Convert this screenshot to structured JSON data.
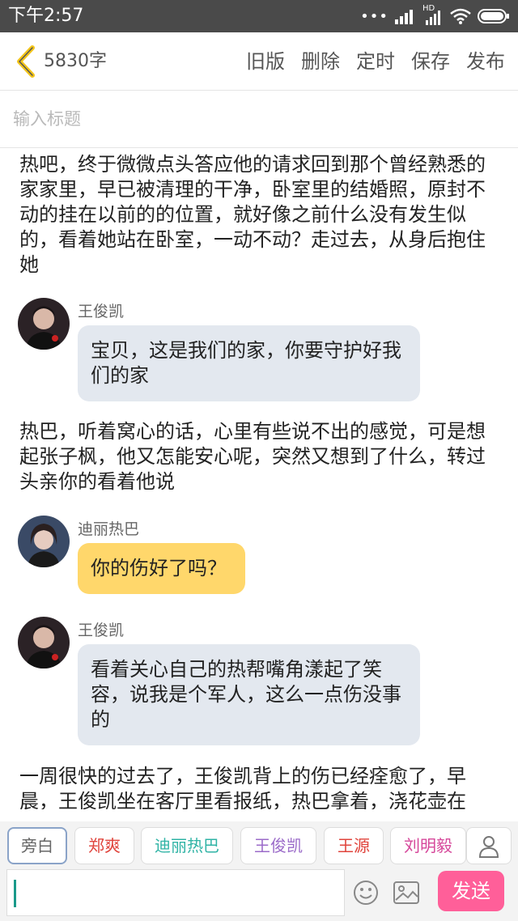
{
  "status": {
    "time": "下午2:57",
    "hd": "HD"
  },
  "toolbar": {
    "word_count": "5830字",
    "actions": [
      "旧版",
      "删除",
      "定时",
      "保存",
      "发布"
    ]
  },
  "title_placeholder": "输入标题",
  "story": [
    {
      "type": "narration",
      "text": "热吧，终于微微点头答应他的请求回到那个曾经熟悉的家家里，早已被清理的干净，卧室里的结婚照，原封不动的挂在以前的的位置，就好像之前什么没有发生似的，看着她站在卧室，一动不动？走过去，从身后抱住她"
    },
    {
      "type": "message",
      "speaker": "王俊凯",
      "text": "宝贝，这是我们的家，你要守护好我们的家",
      "color": "gray"
    },
    {
      "type": "narration",
      "text": "热巴，听着窝心的话，心里有些说不出的感觉，可是想起张子枫，他又怎能安心呢，突然又想到了什么，转过头亲你的看着他说"
    },
    {
      "type": "message",
      "speaker": "迪丽热巴",
      "text": "你的伤好了吗？",
      "color": "yellow"
    },
    {
      "type": "message",
      "speaker": "王俊凯",
      "text": "看着关心自己的热帮嘴角漾起了笑容，说我是个军人，这么一点伤没事的",
      "color": "gray"
    },
    {
      "type": "narration",
      "text": "一周很快的过去了，王俊凯背上的伤已经痊愈了，早晨，王俊凯坐在客厅里看报纸，热巴拿着，浇花壶在"
    }
  ],
  "characters": [
    {
      "label": "旁白",
      "color": "#666666",
      "active": true
    },
    {
      "label": "郑爽",
      "color": "#e0443c",
      "active": false
    },
    {
      "label": "迪丽热巴",
      "color": "#2fb3a5",
      "active": false
    },
    {
      "label": "王俊凯",
      "color": "#9b6bc9",
      "active": false
    },
    {
      "label": "王源",
      "color": "#e0443c",
      "active": false
    },
    {
      "label": "刘明毅",
      "color": "#d6479a",
      "active": false
    }
  ],
  "composer": {
    "send_label": "发送"
  },
  "colors": {
    "status_bar": "#4a4a4a",
    "back_chevron": "#f3c51a",
    "send_button": "#ff5f99"
  }
}
